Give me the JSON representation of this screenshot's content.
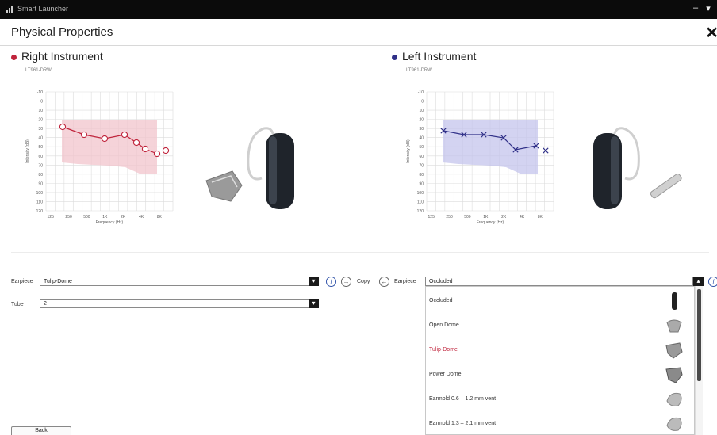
{
  "window": {
    "title": "Smart Launcher",
    "minimize_label": "–",
    "pin_label": "▾"
  },
  "header": {
    "title": "Physical Properties",
    "close_label": "✕"
  },
  "right": {
    "title": "Right Instrument",
    "model": "LT961-DRW",
    "color": "#c0243c"
  },
  "left": {
    "title": "Left Instrument",
    "model": "LT961-DRW",
    "color": "#303088"
  },
  "audiogram": {
    "y_ticks": [
      "-10",
      "0",
      "10",
      "20",
      "30",
      "40",
      "50",
      "60",
      "70",
      "80",
      "90",
      "100",
      "110",
      "120"
    ],
    "x_ticks": [
      "125",
      "250",
      "500",
      "1K",
      "2K",
      "4K",
      "8K"
    ],
    "xlabel": "Frequency (Hz)",
    "ylabel": "Intensity (dB)"
  },
  "controls": {
    "earpiece_label": "Earpiece",
    "right_earpiece_value": "Tulip-Dome",
    "tube_label": "Tube",
    "tube_value": "2",
    "copy_label": "Copy",
    "left_earpiece_value": "Occluded",
    "info_icon_label": "i",
    "copy_right_arrow": "→",
    "copy_left_arrow": "←",
    "dropdown_arrow": "▾",
    "dropdown_up_arrow": "▴"
  },
  "earpiece_options": [
    {
      "label": "Occluded"
    },
    {
      "label": "Open Dome"
    },
    {
      "label": "Tulip-Dome"
    },
    {
      "label": "Power Dome"
    },
    {
      "label": "Earmold  0.6 – 1.2 mm vent"
    },
    {
      "label": "Earmold  1.3 – 2.1 mm vent"
    }
  ],
  "selected_right_option": "Tulip-Dome",
  "footer": {
    "back_label": "Back"
  }
}
